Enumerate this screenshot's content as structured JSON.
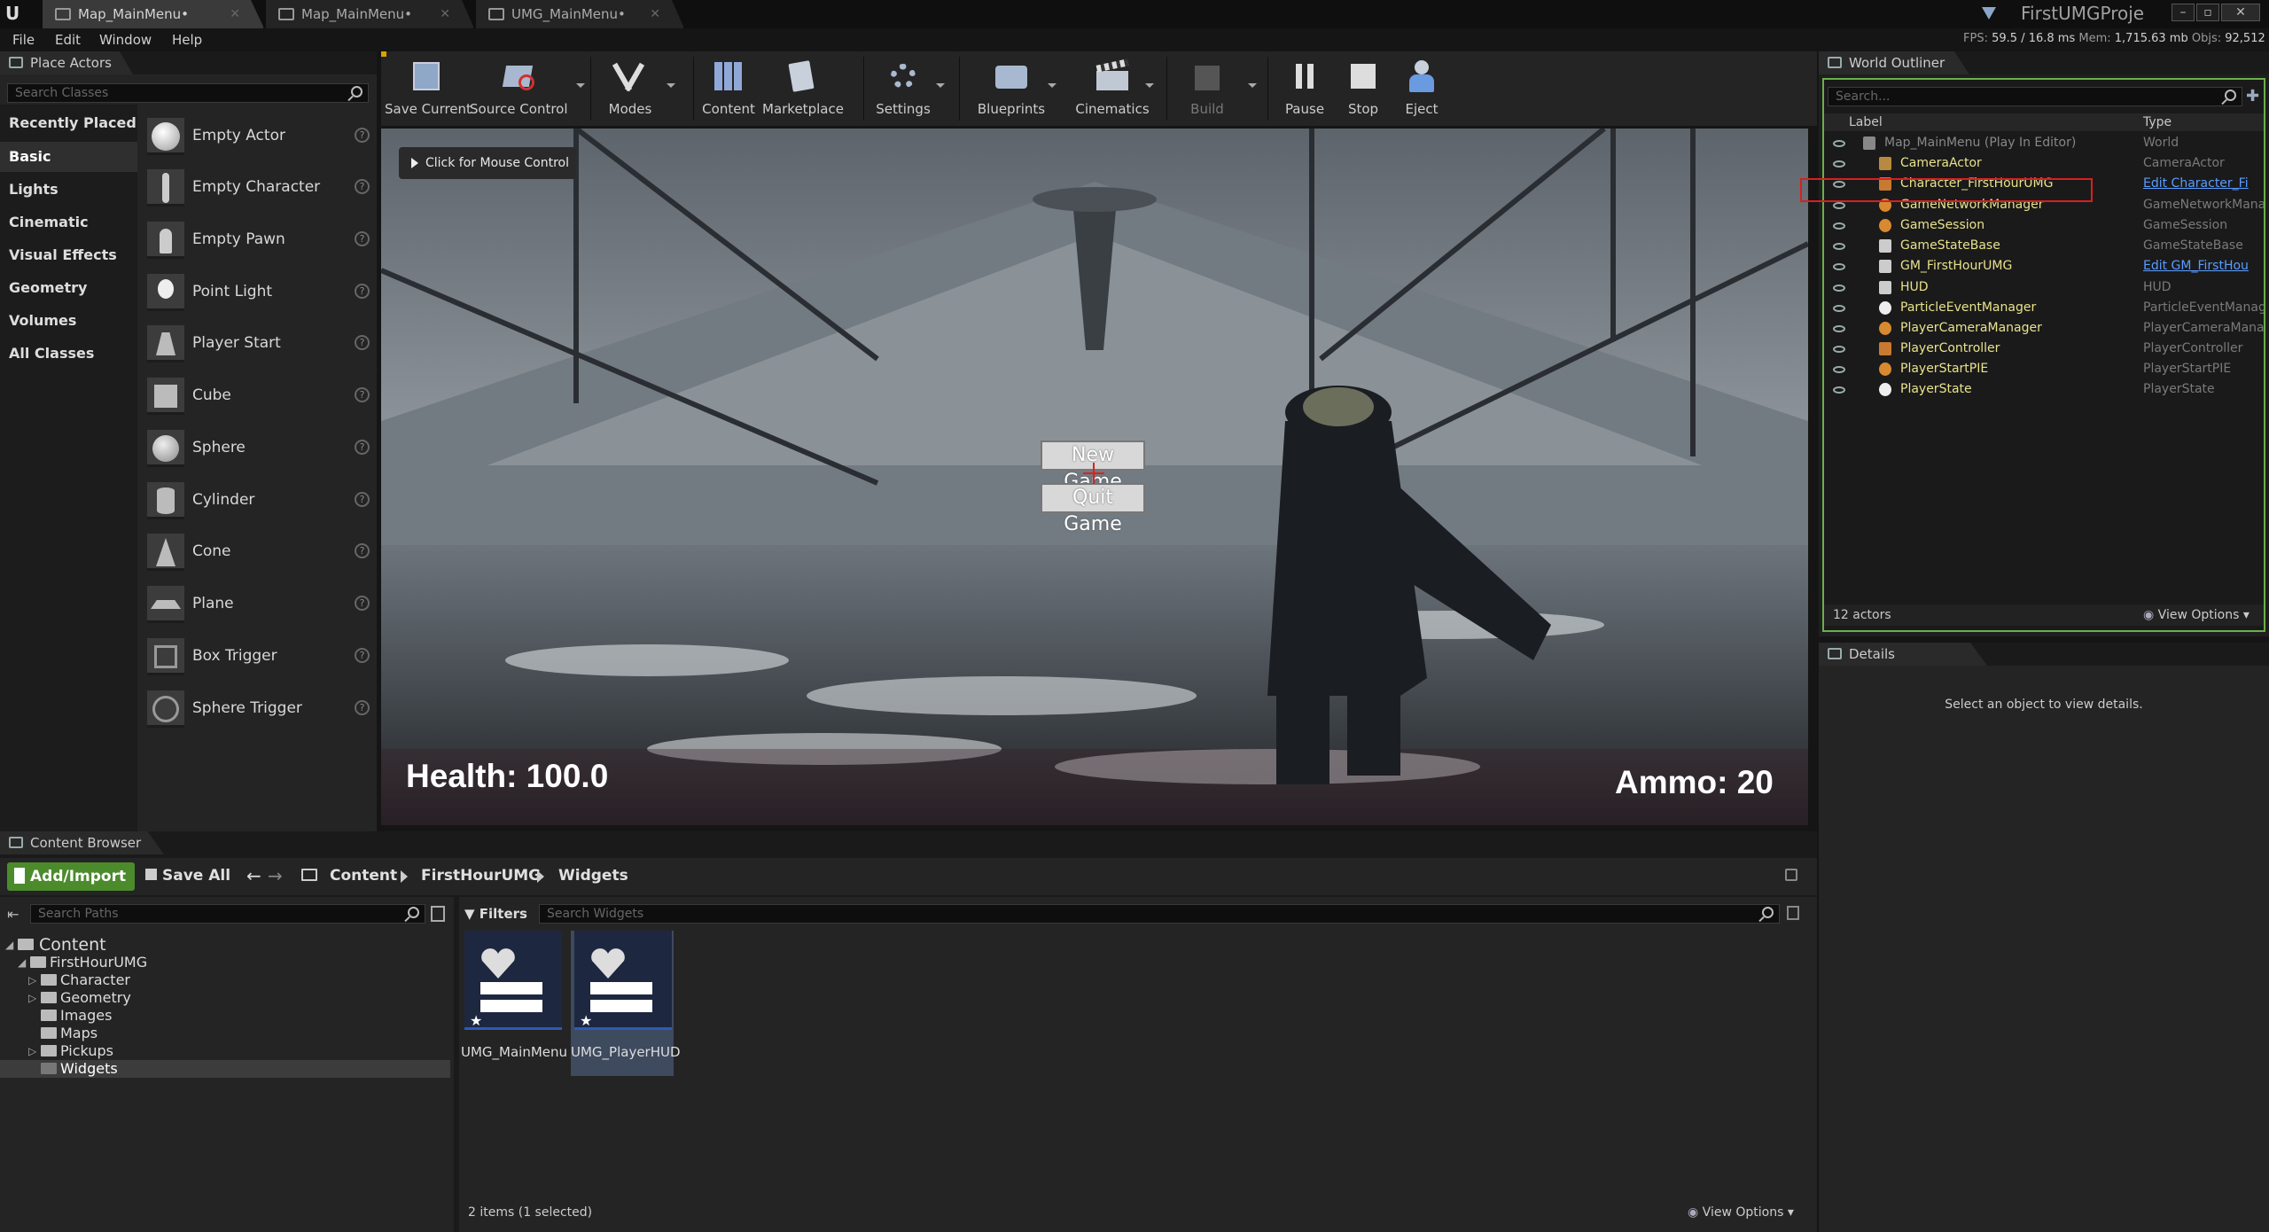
{
  "window": {
    "tabs": [
      {
        "label": "Map_MainMenu•",
        "active": true
      },
      {
        "label": "Map_MainMenu•",
        "active": false
      },
      {
        "label": "UMG_MainMenu•",
        "active": false
      }
    ],
    "project": "FirstUMGProje",
    "buttons": {
      "min": "–",
      "max": "▫",
      "close": "✕"
    }
  },
  "menu": [
    "File",
    "Edit",
    "Window",
    "Help"
  ],
  "stats": {
    "fps_label": "FPS:",
    "fps": "59.5",
    "ms": "/ 16.8 ms",
    "mem_label": "Mem:",
    "mem": "1,715.63 mb",
    "objs_label": "Objs:",
    "objs": "92,512"
  },
  "place_actors": {
    "title": "Place Actors",
    "search_placeholder": "Search Classes",
    "categories": [
      "Recently Placed",
      "Basic",
      "Lights",
      "Cinematic",
      "Visual Effects",
      "Geometry",
      "Volumes",
      "All Classes"
    ],
    "selected_category": "Basic",
    "actors": [
      "Empty Actor",
      "Empty Character",
      "Empty Pawn",
      "Point Light",
      "Player Start",
      "Cube",
      "Sphere",
      "Cylinder",
      "Cone",
      "Plane",
      "Box Trigger",
      "Sphere Trigger"
    ]
  },
  "toolbar": {
    "save_current": "Save Current",
    "source_control": "Source Control",
    "modes": "Modes",
    "content": "Content",
    "marketplace": "Marketplace",
    "settings": "Settings",
    "blueprints": "Blueprints",
    "cinematics": "Cinematics",
    "build": "Build",
    "pause": "Pause",
    "stop": "Stop",
    "eject": "Eject"
  },
  "viewport": {
    "mouse_control": "Click for Mouse Control",
    "new_game": "New Game",
    "quit_game": "Quit Game",
    "health": "Health: 100.0",
    "ammo": "Ammo: 20"
  },
  "outliner": {
    "title": "World Outliner",
    "search_placeholder": "Search...",
    "col_label": "Label",
    "col_type": "Type",
    "rows": [
      {
        "label": "Map_MainMenu (Play In Editor)",
        "type": "World",
        "root": true
      },
      {
        "label": "CameraActor",
        "type": "CameraActor"
      },
      {
        "label": "Character_FirstHourUMG",
        "type": "Edit Character_Fi",
        "link": true
      },
      {
        "label": "GameNetworkManager",
        "type": "GameNetworkMana"
      },
      {
        "label": "GameSession",
        "type": "GameSession"
      },
      {
        "label": "GameStateBase",
        "type": "GameStateBase"
      },
      {
        "label": "GM_FirstHourUMG",
        "type": "Edit GM_FirstHou",
        "link": true
      },
      {
        "label": "HUD",
        "type": "HUD"
      },
      {
        "label": "ParticleEventManager",
        "type": "ParticleEventManag"
      },
      {
        "label": "PlayerCameraManager",
        "type": "PlayerCameraMana"
      },
      {
        "label": "PlayerController",
        "type": "PlayerController"
      },
      {
        "label": "PlayerStartPIE",
        "type": "PlayerStartPIE"
      },
      {
        "label": "PlayerState",
        "type": "PlayerState"
      }
    ],
    "count": "12 actors",
    "view_options": "View Options"
  },
  "details": {
    "title": "Details",
    "empty_msg": "Select an object to view details."
  },
  "content_browser": {
    "title": "Content Browser",
    "add_import": "Add/Import",
    "save_all": "Save All",
    "breadcrumbs": [
      "Content",
      "FirstHourUMG",
      "Widgets"
    ],
    "search_paths_placeholder": "Search Paths",
    "filters": "Filters",
    "search_widgets_placeholder": "Search Widgets",
    "tree": [
      {
        "label": "Content",
        "depth": 0
      },
      {
        "label": "FirstHourUMG",
        "depth": 1
      },
      {
        "label": "Character",
        "depth": 2
      },
      {
        "label": "Geometry",
        "depth": 2
      },
      {
        "label": "Images",
        "depth": 2
      },
      {
        "label": "Maps",
        "depth": 2
      },
      {
        "label": "Pickups",
        "depth": 2
      },
      {
        "label": "Widgets",
        "depth": 2,
        "selected": true
      }
    ],
    "assets": [
      {
        "label": "UMG_MainMenu",
        "selected": false
      },
      {
        "label": "UMG_PlayerHUD",
        "selected": true
      }
    ],
    "status": "2 items (1 selected)",
    "view_options": "View Options"
  }
}
